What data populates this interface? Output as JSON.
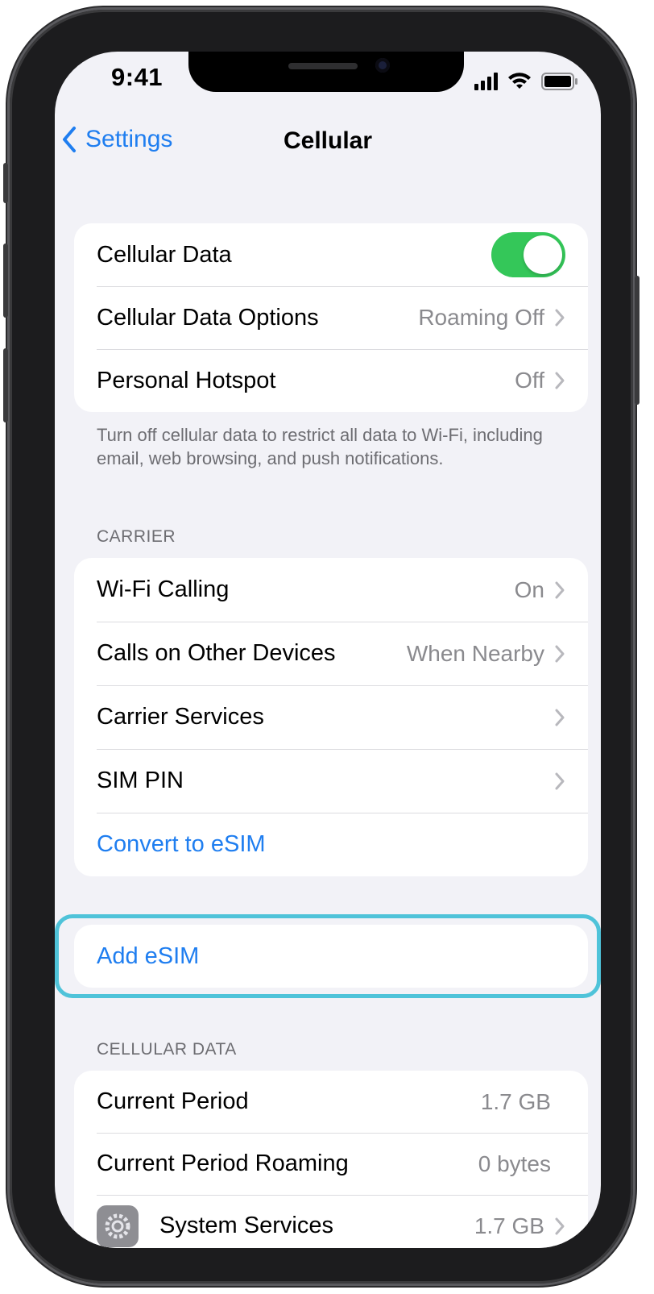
{
  "status_bar": {
    "time": "9:41"
  },
  "nav": {
    "back_label": "Settings",
    "title": "Cellular"
  },
  "group_main": {
    "rows": [
      {
        "label": "Cellular Data",
        "toggle_on": true
      },
      {
        "label": "Cellular Data Options",
        "value": "Roaming Off"
      },
      {
        "label": "Personal Hotspot",
        "value": "Off"
      }
    ],
    "footer": "Turn off cellular data to restrict all data to Wi-Fi, including email, web browsing, and push notifications."
  },
  "carrier": {
    "header": "CARRIER",
    "rows": [
      {
        "label": "Wi-Fi Calling",
        "value": "On"
      },
      {
        "label": "Calls on Other Devices",
        "value": "When Nearby"
      },
      {
        "label": "Carrier Services",
        "value": ""
      },
      {
        "label": "SIM PIN",
        "value": ""
      }
    ],
    "convert_label": "Convert to eSIM"
  },
  "add_esim": {
    "label": "Add eSIM"
  },
  "cellular_data": {
    "header": "CELLULAR DATA",
    "rows": [
      {
        "label": "Current Period",
        "value": "1.7 GB"
      },
      {
        "label": "Current Period Roaming",
        "value": "0 bytes"
      },
      {
        "label": "System Services",
        "value": "1.7 GB"
      }
    ]
  },
  "colors": {
    "accent": "#1f7ef0",
    "toggle_on": "#34c759",
    "highlight": "#4fc3d9",
    "background": "#f2f2f7"
  },
  "icons": [
    "chevron-left-icon",
    "chevron-right-icon",
    "signal-icon",
    "wifi-icon",
    "battery-icon",
    "gear-icon"
  ]
}
